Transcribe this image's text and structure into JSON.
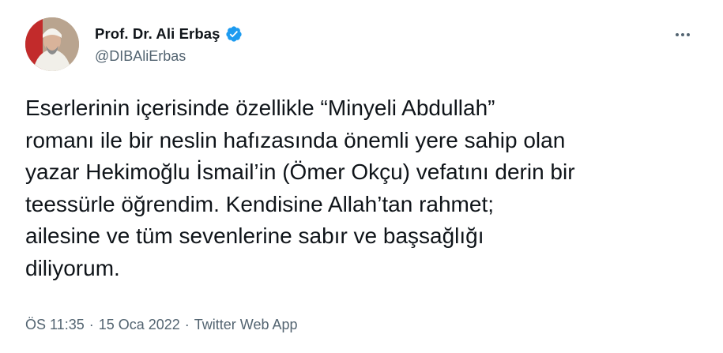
{
  "author": {
    "display_name": "Prof. Dr. Ali Erbaş",
    "handle": "@DIBAliErbas",
    "verified_icon": "verified-badge-icon"
  },
  "menu": {
    "icon": "more-horizontal-icon"
  },
  "tweet": {
    "lines": [
      "Eserlerinin içerisinde özellikle “Minyeli Abdullah”",
      "romanı ile bir neslin hafızasında önemli yere sahip olan",
      "yazar Hekimoğlu İsmail’in (Ömer Okçu) vefatını derin bir",
      "teessürle öğrendim. Kendisine Allah’tan rahmet;",
      "ailesine ve tüm sevenlerine sabır ve başsağlığı",
      "diliyorum."
    ]
  },
  "meta": {
    "time": "ÖS 11:35",
    "separator": "·",
    "date": "15 Oca 2022",
    "source": "Twitter Web App"
  },
  "colors": {
    "text": "#0f1419",
    "secondary": "#536471",
    "verified": "#1d9bf0"
  }
}
